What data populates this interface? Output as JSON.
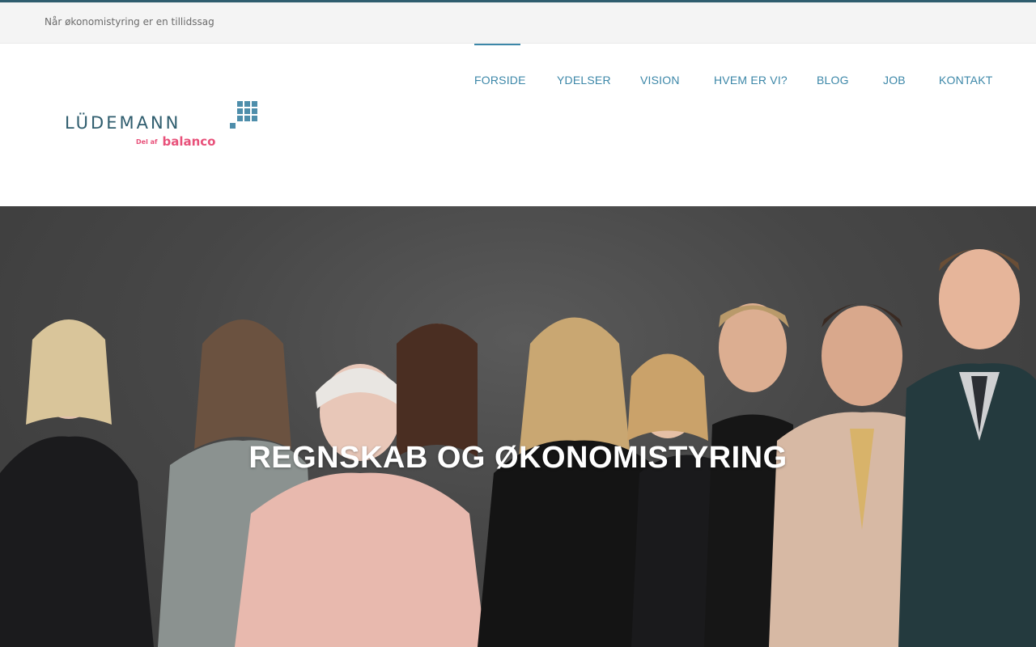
{
  "topbar": {
    "tagline": "Når økonomistyring er en tillidssag"
  },
  "logo": {
    "wordmark": "LÜDEMANN",
    "sub_prefix": "Del af",
    "sub_brand": "balanco"
  },
  "nav": {
    "items": [
      {
        "label": "FORSIDE",
        "active": true
      },
      {
        "label": "YDELSER",
        "active": false
      },
      {
        "label": "VISION",
        "active": false
      },
      {
        "label": "HVEM ER VI?",
        "active": false
      },
      {
        "label": "BLOG",
        "active": false
      },
      {
        "label": "JOB",
        "active": false
      },
      {
        "label": "KONTAKT",
        "active": false
      }
    ]
  },
  "hero": {
    "title": "REGNSKAB OG ØKONOMISTYRING"
  },
  "colors": {
    "brand_teal": "#2f5d6e",
    "nav_blue": "#3c87a8",
    "accent_pink": "#e8517a"
  }
}
